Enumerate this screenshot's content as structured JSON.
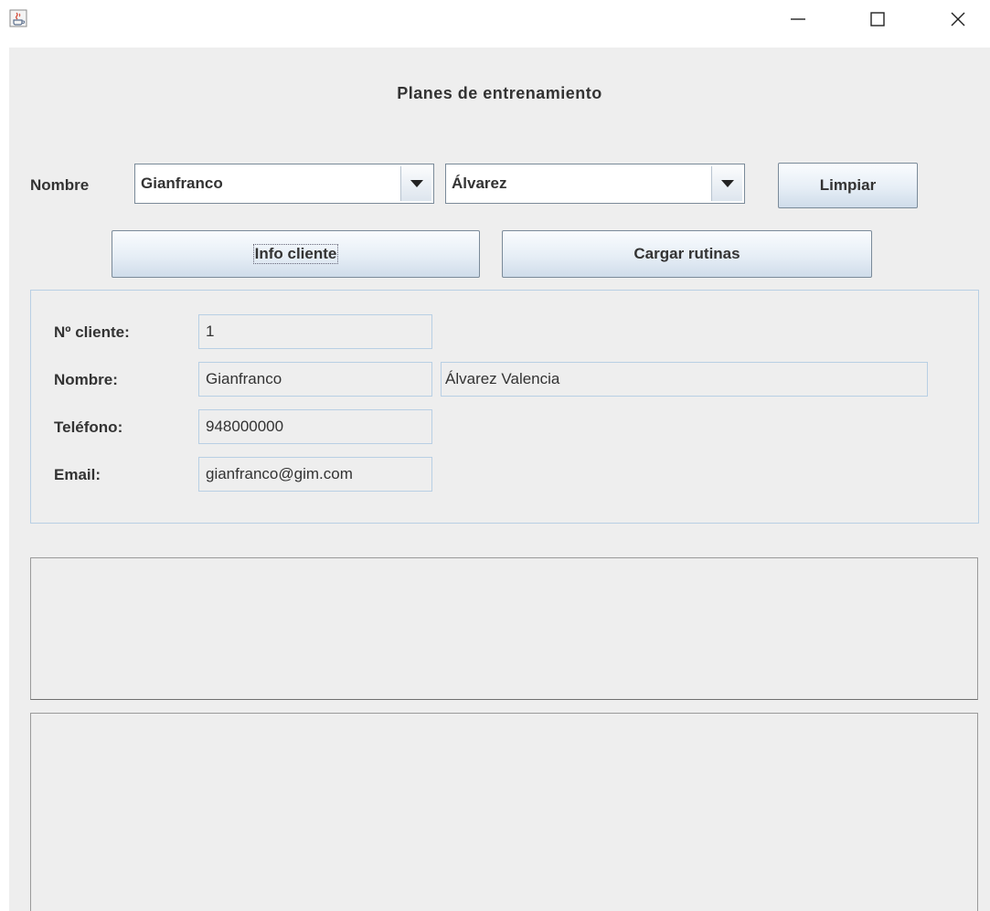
{
  "window": {
    "app_icon": "java-cup-icon",
    "minimize_icon": "minimize-icon",
    "maximize_icon": "maximize-icon",
    "close_icon": "close-icon"
  },
  "header": {
    "title": "Planes de entrenamiento"
  },
  "search": {
    "name_label": "Nombre",
    "first_name_value": "Gianfranco",
    "last_name_value": "Álvarez",
    "clear_label": "Limpiar"
  },
  "actions": {
    "info_label": "Info cliente",
    "load_label": "Cargar rutinas"
  },
  "client": {
    "number_label": "Nº cliente:",
    "number_value": "1",
    "name_label": "Nombre:",
    "first_name": "Gianfranco",
    "surnames": "Álvarez Valencia",
    "phone_label": "Teléfono:",
    "phone_value": "948000000",
    "email_label": "Email:",
    "email_value": "gianfranco@gim.com"
  },
  "colors": {
    "window_bg": "#eeeeee",
    "panel_border": "#b8cfe4",
    "text": "#333333"
  }
}
